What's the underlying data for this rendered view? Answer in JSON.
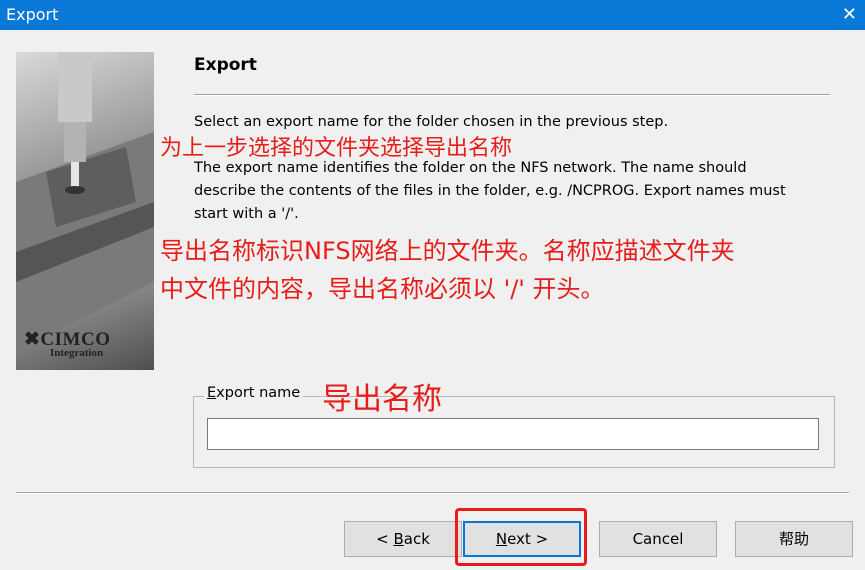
{
  "window": {
    "title": "Export",
    "close_glyph": "✕"
  },
  "logo": {
    "brand": "CIMCO",
    "sub": "Integration"
  },
  "heading": "Export",
  "desc": {
    "line1": "Select an export name for the folder chosen in the previous step.",
    "line2": "The export name identifies the folder on the NFS network. The name should",
    "line3": "describe the contents of the files in the folder, e.g. /NCPROG. Export names must",
    "line4": "start with a '/'."
  },
  "annotations": {
    "cn1": "为上一步选择的文件夹选择导出名称",
    "cn2_line1": "导出名称标识NFS网络上的文件夹。名称应描述文件夹",
    "cn2_line2": "中文件的内容，导出名称必须以 '/' 开头。",
    "cn3": "导出名称",
    "highlight_color": "#e61d19"
  },
  "export_name": {
    "label_pre": "",
    "label_u": "E",
    "label_post": "xport name",
    "value": "",
    "placeholder": ""
  },
  "buttons": {
    "back_pre": "< ",
    "back_u": "B",
    "back_post": "ack",
    "next_u": "N",
    "next_post": "ext >",
    "cancel": "Cancel",
    "help": "帮助"
  },
  "colors": {
    "titlebar": "#0a78d7",
    "default_button_border": "#0078d7"
  }
}
